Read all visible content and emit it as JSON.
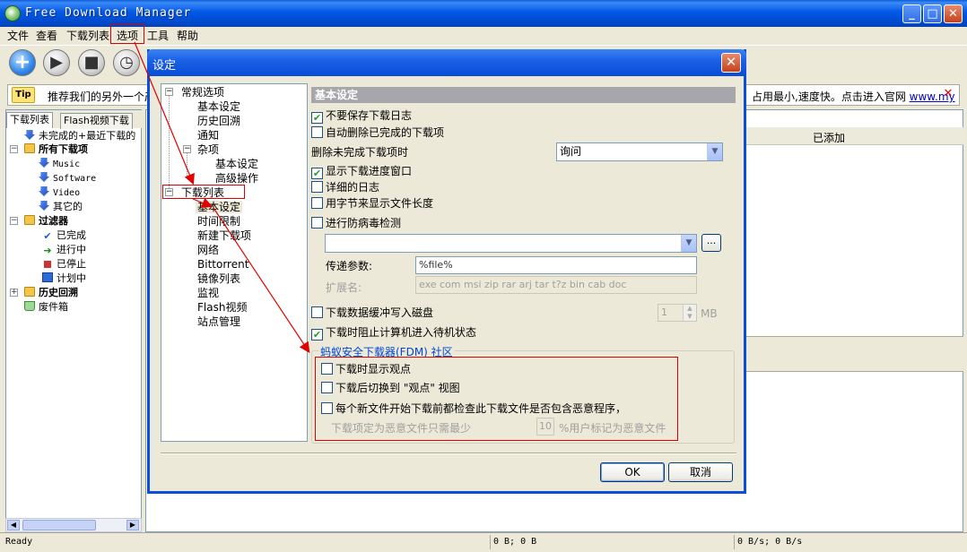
{
  "window": {
    "title": "Free Download Manager"
  },
  "menu": [
    "文件",
    "查看",
    "下载列表",
    "选项",
    "工具",
    "帮助"
  ],
  "tip": {
    "icon_label": "Tip",
    "text_left": "推荐我们的另外一个产",
    "text_right": "占用最小,速度快。点击进入官网",
    "link": "www.my"
  },
  "left_tabs": [
    "下载列表",
    "Flash视频下载"
  ],
  "left_tree": {
    "incomplete": "未完成的+最近下载的",
    "all": "所有下载项",
    "music": "Music",
    "software": "Software",
    "video": "Video",
    "other": "其它的",
    "filters": "过滤器",
    "completed": "已完成",
    "in_progress": "进行中",
    "stopped": "已停止",
    "scheduled": "计划中",
    "history": "历史回溯",
    "recycle": "废件箱"
  },
  "list_header": {
    "added": "已添加"
  },
  "status": {
    "ready": "Ready",
    "size": "0 B; 0 B",
    "speed": "0 B/s; 0 B/s"
  },
  "dialog": {
    "title": "设定",
    "tree": {
      "general": "常规选项",
      "basic": "基本设定",
      "history": "历史回溯",
      "notify": "通知",
      "misc": "杂项",
      "misc_basic": "基本设定",
      "advanced": "高级操作",
      "download_list": "下载列表",
      "dl_basic": "基本设定",
      "time_limit": "时间限制",
      "new_download": "新建下载项",
      "network": "网络",
      "bittorrent": "Bittorrent",
      "mirror": "镜像列表",
      "monitor": "监视",
      "flash": "Flash视频",
      "site": "站点管理"
    },
    "section_title": "基本设定",
    "options": {
      "no_save_log": "不要保存下载日志",
      "auto_delete": "自动删除已完成的下载项",
      "delete_incomplete_label": "删除未完成下载项时",
      "delete_incomplete_value": "询问",
      "show_progress": "显示下载进度窗口",
      "detailed_log": "详细的日志",
      "bytes_length": "用字节来显示文件长度",
      "virus_check": "进行防病毒检测",
      "param_label": "传递参数:",
      "param_value": "%file%",
      "ext_label": "扩展名:",
      "ext_value": "exe com msi zip rar arj tar t?z bin cab doc",
      "buffer_disk": "下载数据缓冲写入磁盘",
      "buffer_value": "1",
      "buffer_unit": "MB",
      "prevent_standby": "下载时阻止计算机进入待机状态"
    },
    "community": {
      "title": "蚂蚁安全下载器(FDM) 社区",
      "show_opinions": "下载时显示观点",
      "switch_view": "下载后切换到 \"观点\" 视图",
      "check_malicious": "每个新文件开始下载前都检查此下载文件是否包含恶意程序，",
      "min_label": "下载项定为恶意文件只需最少",
      "min_value": "10",
      "min_suffix": "%用户标记为恶意文件"
    },
    "ok": "OK",
    "cancel": "取消"
  }
}
